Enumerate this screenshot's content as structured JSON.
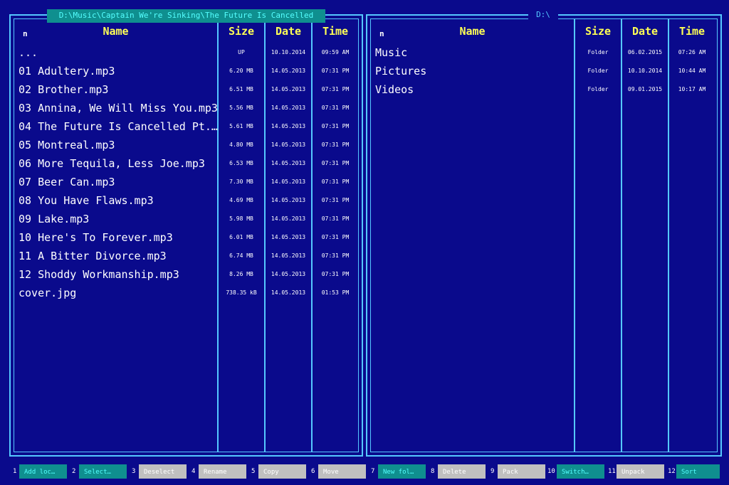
{
  "left_panel": {
    "path": "D:\\Music\\Captain We're Sinking\\The Future Is Cancelled",
    "headers": {
      "n": "n",
      "name": "Name",
      "size": "Size",
      "date": "Date",
      "time": "Time"
    },
    "rows": [
      {
        "name": "...",
        "size": "UP",
        "date": "10.10.2014",
        "time": "09:59 AM"
      },
      {
        "name": "01 Adultery.mp3",
        "size": "6.20 MB",
        "date": "14.05.2013",
        "time": "07:31 PM"
      },
      {
        "name": "02 Brother.mp3",
        "size": "6.51 MB",
        "date": "14.05.2013",
        "time": "07:31 PM"
      },
      {
        "name": "03 Annina, We Will Miss You.mp3",
        "size": "5.56 MB",
        "date": "14.05.2013",
        "time": "07:31 PM"
      },
      {
        "name": "04 The Future Is Cancelled Pt.…",
        "size": "5.61 MB",
        "date": "14.05.2013",
        "time": "07:31 PM"
      },
      {
        "name": "05 Montreal.mp3",
        "size": "4.80 MB",
        "date": "14.05.2013",
        "time": "07:31 PM"
      },
      {
        "name": "06 More Tequila, Less Joe.mp3",
        "size": "6.53 MB",
        "date": "14.05.2013",
        "time": "07:31 PM"
      },
      {
        "name": "07 Beer Can.mp3",
        "size": "7.30 MB",
        "date": "14.05.2013",
        "time": "07:31 PM"
      },
      {
        "name": "08 You Have Flaws.mp3",
        "size": "4.69 MB",
        "date": "14.05.2013",
        "time": "07:31 PM"
      },
      {
        "name": "09 Lake.mp3",
        "size": "5.98 MB",
        "date": "14.05.2013",
        "time": "07:31 PM"
      },
      {
        "name": "10 Here's To Forever.mp3",
        "size": "6.01 MB",
        "date": "14.05.2013",
        "time": "07:31 PM"
      },
      {
        "name": "11 A Bitter Divorce.mp3",
        "size": "6.74 MB",
        "date": "14.05.2013",
        "time": "07:31 PM"
      },
      {
        "name": "12 Shoddy Workmanship.mp3",
        "size": "8.26 MB",
        "date": "14.05.2013",
        "time": "07:31 PM"
      },
      {
        "name": "cover.jpg",
        "size": "738.35 kB",
        "date": "14.05.2013",
        "time": "01:53 PM"
      }
    ]
  },
  "right_panel": {
    "path": "D:\\",
    "headers": {
      "n": "n",
      "name": "Name",
      "size": "Size",
      "date": "Date",
      "time": "Time"
    },
    "rows": [
      {
        "name": "Music",
        "size": "Folder",
        "date": "06.02.2015",
        "time": "07:26 AM"
      },
      {
        "name": "Pictures",
        "size": "Folder",
        "date": "10.10.2014",
        "time": "10:44 AM"
      },
      {
        "name": "Videos",
        "size": "Folder",
        "date": "09.01.2015",
        "time": "10:17 AM"
      }
    ]
  },
  "function_keys": [
    {
      "num": "1",
      "label": "Add loc…",
      "style": "teal"
    },
    {
      "num": "2",
      "label": "Select…",
      "style": "teal"
    },
    {
      "num": "3",
      "label": "Deselect",
      "style": "gray"
    },
    {
      "num": "4",
      "label": "Rename",
      "style": "gray"
    },
    {
      "num": "5",
      "label": "Copy",
      "style": "gray"
    },
    {
      "num": "6",
      "label": "Move",
      "style": "gray"
    },
    {
      "num": "7",
      "label": "New fol…",
      "style": "teal"
    },
    {
      "num": "8",
      "label": "Delete",
      "style": "gray"
    },
    {
      "num": "9",
      "label": "Pack",
      "style": "gray"
    },
    {
      "num": "10",
      "label": "Switch…",
      "style": "teal"
    },
    {
      "num": "11",
      "label": "Unpack",
      "style": "gray"
    },
    {
      "num": "12",
      "label": "Sort",
      "style": "teal"
    }
  ],
  "colors": {
    "background": "#0a0a8c",
    "border": "#55c8ff",
    "header_text": "#ffff55",
    "teal_button": "#0f8f8f",
    "gray_button": "#c0c0c0"
  }
}
